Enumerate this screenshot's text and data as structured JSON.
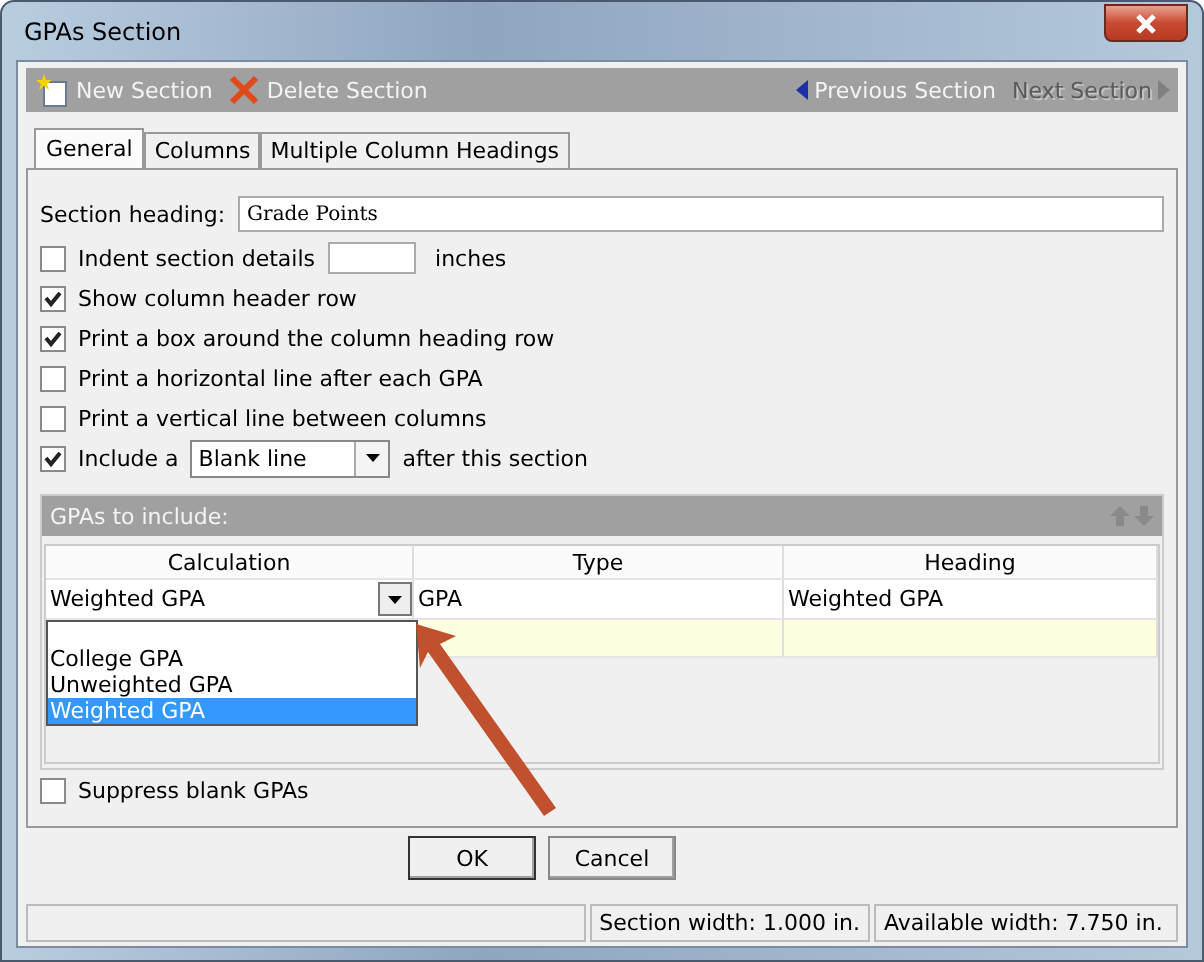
{
  "window": {
    "title": "GPAs Section"
  },
  "toolbar": {
    "items": [
      {
        "label": "New Section",
        "kind": "new",
        "disabled": false
      },
      {
        "label": "Delete Section",
        "kind": "delete",
        "disabled": false
      },
      {
        "label": "Previous Section",
        "kind": "previous",
        "disabled": false
      },
      {
        "label": "Next Section",
        "kind": "next",
        "disabled": true
      }
    ]
  },
  "tabs": [
    {
      "label": "General",
      "selected": true
    },
    {
      "label": "Columns",
      "selected": false
    },
    {
      "label": "Multiple Column Headings",
      "selected": false
    }
  ],
  "section_heading": {
    "label": "Section heading:",
    "value": "Grade Points"
  },
  "options": [
    {
      "kind": "input",
      "label": "Indent section details",
      "checked": false,
      "suffix": "inches"
    },
    {
      "kind": "plain",
      "label": "Show column header row",
      "checked": true
    },
    {
      "kind": "plain",
      "label": "Print a box around the column heading row",
      "checked": true
    },
    {
      "kind": "plain",
      "label": "Print a horizontal line after each GPA",
      "checked": false
    },
    {
      "kind": "plain",
      "label": "Print a vertical line between columns",
      "checked": false
    },
    {
      "kind": "select",
      "label": "Include a",
      "checked": true,
      "value": "Blank line",
      "suffix": "after this section"
    }
  ],
  "gpa_group": {
    "title": "GPAs to include:",
    "columns": [
      "Calculation",
      "Type",
      "Heading"
    ],
    "rows": [
      [
        "Weighted GPA",
        "GPA",
        "Weighted GPA"
      ]
    ],
    "dropdown": [
      {
        "label": "College GPA",
        "selected": false
      },
      {
        "label": "Unweighted GPA",
        "selected": false
      },
      {
        "label": "Weighted GPA",
        "selected": true
      }
    ]
  },
  "suppress": {
    "label": "Suppress blank GPAs",
    "checked": false
  },
  "buttons": [
    "OK",
    "Cancel"
  ],
  "status_bar": [
    "Section width: 1.000 in.",
    "Available width: 7.750 in."
  ]
}
